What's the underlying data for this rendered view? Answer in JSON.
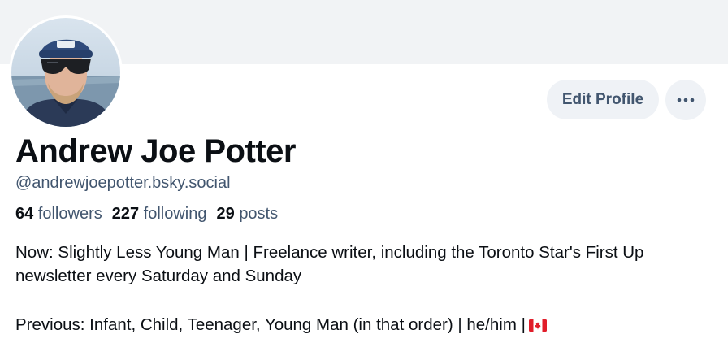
{
  "profile": {
    "name": "Andrew Joe Potter",
    "handle": "@andrewjoepotter.bsky.social",
    "stats": {
      "followers_count": "64",
      "followers_label": "followers",
      "following_count": "227",
      "following_label": "following",
      "posts_count": "29",
      "posts_label": "posts"
    },
    "bio_line1": "Now: Slightly Less Young Man | Freelance writer, including the Toronto Star's First Up newsletter every Saturday and Sunday",
    "bio_line2": "Previous: Infant, Child, Teenager, Young Man (in that order) | he/him |",
    "bio_flag_icon": "canada-flag-icon"
  },
  "actions": {
    "edit_profile_label": "Edit Profile",
    "more_icon": "ellipsis-icon"
  },
  "colors": {
    "banner": "#f1f3f5",
    "button_bg": "#eff2f6",
    "muted_text": "#42566f",
    "text": "#0b0f14"
  }
}
